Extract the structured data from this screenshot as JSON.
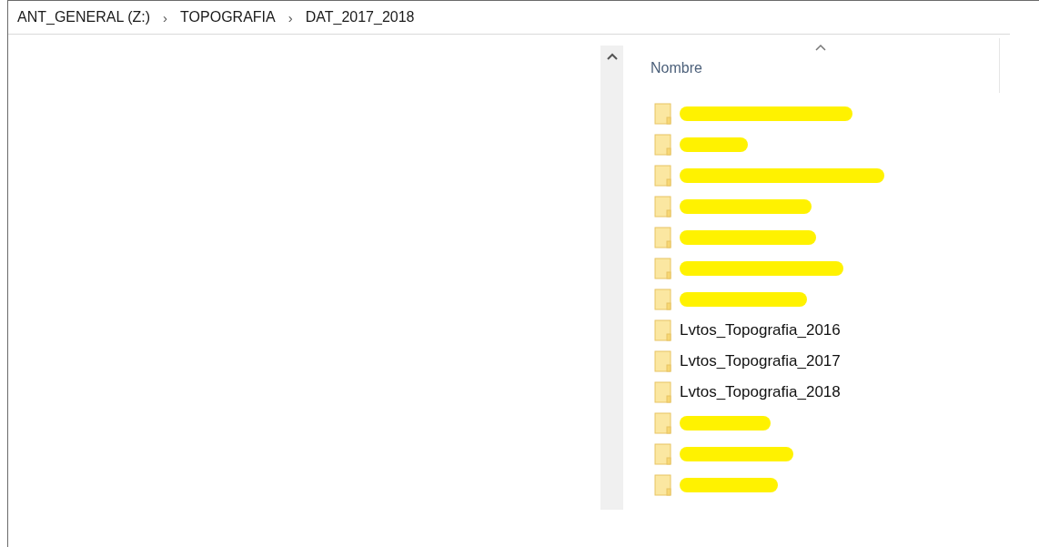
{
  "breadcrumb": [
    {
      "label": "ANT_GENERAL (Z:)"
    },
    {
      "label": "TOPOGRAFIA"
    },
    {
      "label": "DAT_2017_2018"
    }
  ],
  "separator": "›",
  "file_list": {
    "column": "Nombre",
    "sort_ascending": true,
    "rows": [
      {
        "redacted": true
      },
      {
        "redacted": true
      },
      {
        "redacted": true
      },
      {
        "redacted": true
      },
      {
        "redacted": true
      },
      {
        "redacted": true
      },
      {
        "redacted": true
      },
      {
        "redacted": false,
        "name": "Lvtos_Topografia_2016"
      },
      {
        "redacted": false,
        "name": "Lvtos_Topografia_2017"
      },
      {
        "redacted": false,
        "name": "Lvtos_Topografia_2018"
      },
      {
        "redacted": true
      },
      {
        "redacted": true
      },
      {
        "redacted": true
      }
    ]
  }
}
